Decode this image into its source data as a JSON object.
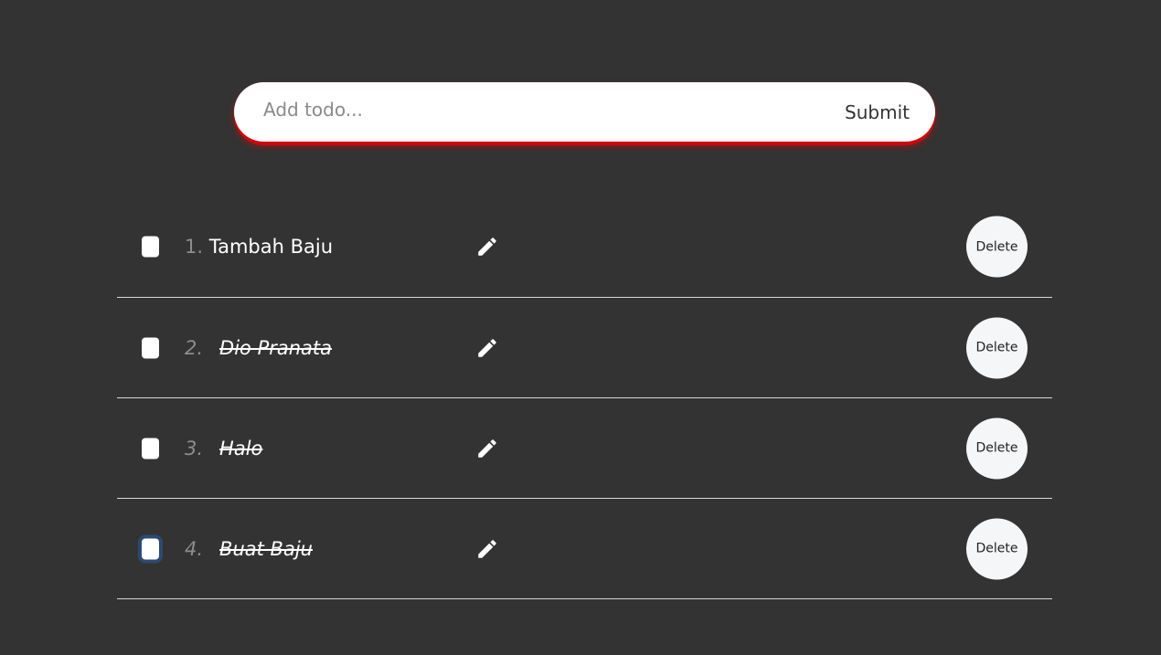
{
  "form": {
    "input_placeholder": "Add todo...",
    "input_value": "",
    "submit_label": "Submit",
    "accent_color": "#d0060b"
  },
  "todos": [
    {
      "number": "1.",
      "text": "Tambah Baju",
      "done": false,
      "edit_icon": "pencil-icon",
      "delete_label": "Delete"
    },
    {
      "number": "2.",
      "text": "Dio Pranata",
      "done": true,
      "edit_icon": "pencil-icon",
      "delete_label": "Delete"
    },
    {
      "number": "3.",
      "text": "Halo",
      "done": true,
      "edit_icon": "pencil-icon",
      "delete_label": "Delete"
    },
    {
      "number": "4.",
      "text": "Buat Baju",
      "done": true,
      "edit_icon": "pencil-icon",
      "delete_label": "Delete"
    }
  ],
  "colors": {
    "background": "#333333",
    "divider": "#d9d9d9",
    "number": "#8c8c8c",
    "focus_ring": "#2b4a72"
  }
}
